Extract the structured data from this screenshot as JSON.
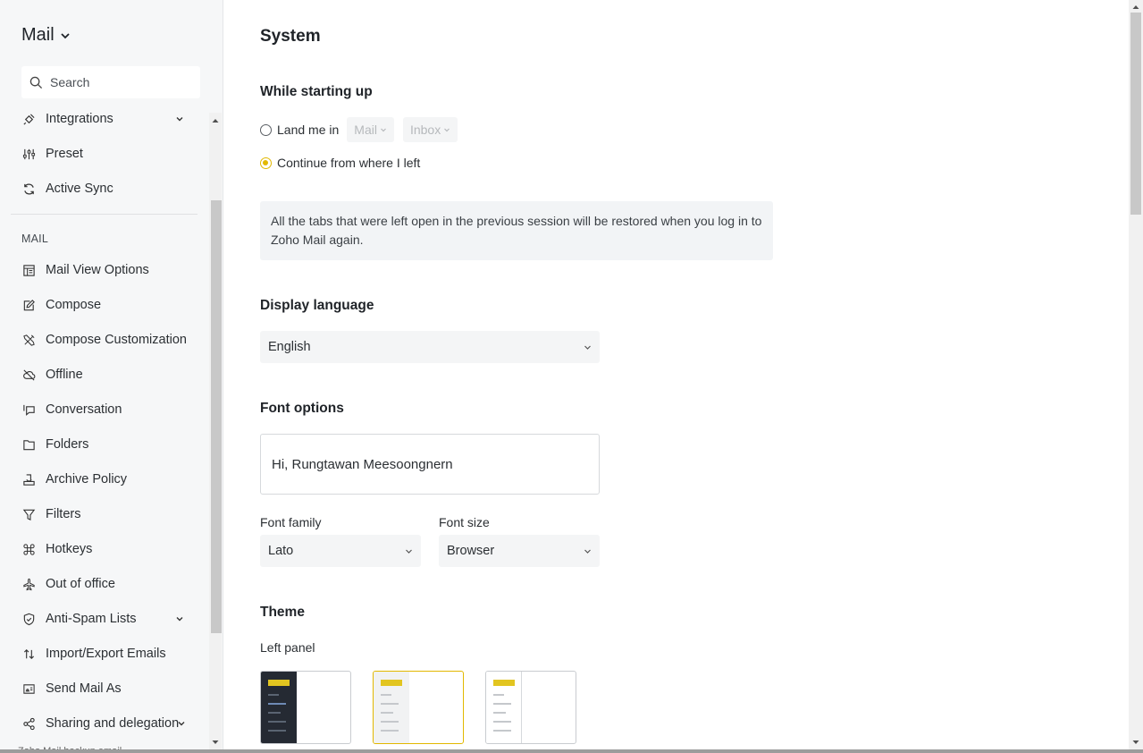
{
  "sidebar": {
    "app_title": "Mail",
    "search_placeholder": "Search",
    "top_items": [
      {
        "label": "Integrations",
        "icon": "plug-icon"
      },
      {
        "label": "Preset",
        "icon": "sliders-icon"
      },
      {
        "label": "Active Sync",
        "icon": "sync-icon"
      }
    ],
    "section_label": "MAIL",
    "mail_items": [
      {
        "label": "Mail View Options",
        "icon": "layout-icon"
      },
      {
        "label": "Compose",
        "icon": "edit-icon"
      },
      {
        "label": "Compose Customization",
        "icon": "tools-icon"
      },
      {
        "label": "Offline",
        "icon": "cloud-off-icon"
      },
      {
        "label": "Conversation",
        "icon": "chat-icon"
      },
      {
        "label": "Folders",
        "icon": "folder-icon"
      },
      {
        "label": "Archive Policy",
        "icon": "archive-icon"
      },
      {
        "label": "Filters",
        "icon": "filter-icon"
      },
      {
        "label": "Hotkeys",
        "icon": "command-icon"
      },
      {
        "label": "Out of office",
        "icon": "plane-icon"
      },
      {
        "label": "Anti-Spam Lists",
        "icon": "shield-icon"
      },
      {
        "label": "Import/Export Emails",
        "icon": "import-export-icon"
      },
      {
        "label": "Send Mail As",
        "icon": "send-as-icon"
      },
      {
        "label": "Sharing and delegation",
        "icon": "share-icon"
      }
    ],
    "cutoff_text": "Zoho Mail backup email"
  },
  "main": {
    "title": "System",
    "startup": {
      "heading": "While starting up",
      "option_land": "Land me in",
      "land_app": "Mail",
      "land_folder": "Inbox",
      "option_continue": "Continue from where I left",
      "selected": "continue",
      "info": "All the tabs that were left open in the previous session will be restored when you log in to Zoho Mail again."
    },
    "language": {
      "heading": "Display language",
      "value": "English"
    },
    "font": {
      "heading": "Font options",
      "preview_text": "Hi, Rungtawan Meesoongnern",
      "family_label": "Font family",
      "family_value": "Lato",
      "size_label": "Font size",
      "size_value": "Browser"
    },
    "theme": {
      "heading": "Theme",
      "left_panel_label": "Left panel",
      "options": [
        "dark",
        "light-gray",
        "white"
      ],
      "selected": "light-gray",
      "accent_color": "#e2c520"
    }
  },
  "colors": {
    "accent": "#e2b800",
    "sidebar_bg": "#f6f7f8",
    "dark_panel": "#252a33"
  }
}
